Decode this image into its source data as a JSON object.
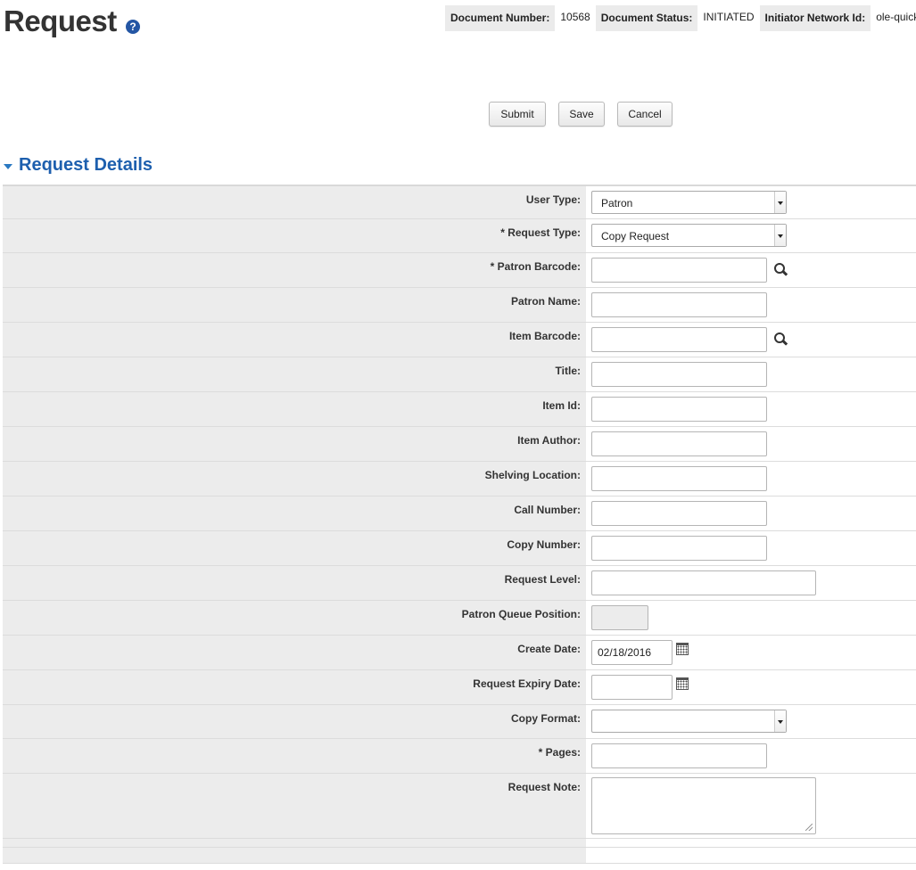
{
  "page": {
    "title": "Request",
    "help_icon": "question-mark-icon"
  },
  "doc_header": {
    "document_number_label": "Document Number:",
    "document_number": "10568",
    "document_status_label": "Document Status:",
    "document_status": "INITIATED",
    "initiator_label": "Initiator Network Id:",
    "initiator": "ole-quicks"
  },
  "actions": {
    "submit": "Submit",
    "save": "Save",
    "cancel": "Cancel"
  },
  "section": {
    "title": "Request Details",
    "toggle_icon": "triangle-down-icon"
  },
  "form": {
    "user_type": {
      "label": "User Type:",
      "value": "Patron"
    },
    "request_type": {
      "label": "* Request Type:",
      "value": "Copy Request"
    },
    "patron_barcode": {
      "label": "* Patron Barcode:",
      "value": ""
    },
    "patron_name": {
      "label": "Patron Name:",
      "value": ""
    },
    "item_barcode": {
      "label": "Item Barcode:",
      "value": ""
    },
    "title": {
      "label": "Title:",
      "value": ""
    },
    "item_id": {
      "label": "Item Id:",
      "value": ""
    },
    "item_author": {
      "label": "Item Author:",
      "value": ""
    },
    "shelving_location": {
      "label": "Shelving Location:",
      "value": ""
    },
    "call_number": {
      "label": "Call Number:",
      "value": ""
    },
    "copy_number": {
      "label": "Copy Number:",
      "value": ""
    },
    "request_level": {
      "label": "Request Level:",
      "value": ""
    },
    "patron_queue_position": {
      "label": "Patron Queue Position:",
      "value": ""
    },
    "create_date": {
      "label": "Create Date:",
      "value": "02/18/2016"
    },
    "request_expiry_date": {
      "label": "Request Expiry Date:",
      "value": ""
    },
    "copy_format": {
      "label": "Copy Format:",
      "value": ""
    },
    "pages": {
      "label": "* Pages:",
      "value": ""
    },
    "request_note": {
      "label": "Request Note:",
      "value": ""
    }
  }
}
